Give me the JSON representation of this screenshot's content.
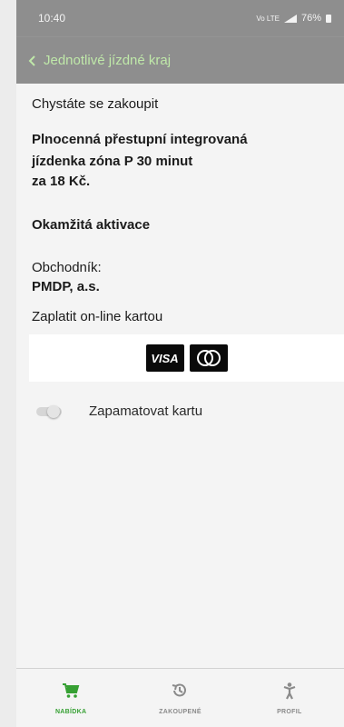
{
  "status_bar": {
    "time": "10:40",
    "network": "Vo LTE",
    "battery": "76%"
  },
  "app_bar": {
    "back_title": "Jednotlivé jízdné kraj"
  },
  "purchase": {
    "intro": "Chystáte se zakoupit",
    "ticket_line1": "Plnocenná přestupní integrovaná",
    "ticket_line2": "jízdenka zóna P 30 minut",
    "ticket_line3": "za 18 Kč.",
    "activation": "Okamžitá aktivace",
    "merchant_label": "Obchodník:",
    "merchant_name": "PMDP, a.s.",
    "pay_label": "Zaplatit on-line kartou"
  },
  "cards": {
    "visa": "VISA"
  },
  "remember_card": {
    "label": "Zapamatovat kartu",
    "enabled": false
  },
  "bottom_nav": {
    "items": [
      {
        "label": "NABÍDKA",
        "icon": "cart-icon",
        "active": true
      },
      {
        "label": "ZAKOUPENÉ",
        "icon": "history-icon",
        "active": false
      },
      {
        "label": "PROFIL",
        "icon": "person-icon",
        "active": false
      }
    ]
  },
  "colors": {
    "accent": "#36a033",
    "header_bg": "#8e8e8e",
    "header_text": "#bfe8a9"
  }
}
